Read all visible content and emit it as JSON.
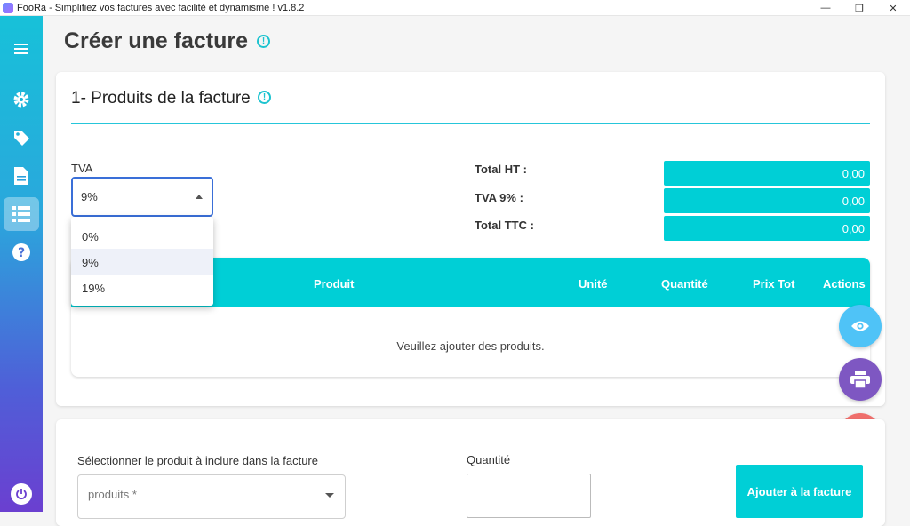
{
  "window": {
    "title": "FooRa - Simplifiez vos factures avec facilité et dynamisme ! v1.8.2",
    "controls": [
      "—",
      "❐",
      "✕"
    ]
  },
  "sidebar": {
    "items": [
      {
        "icon": "menu-icon"
      },
      {
        "icon": "gear-icon"
      },
      {
        "icon": "tag-icon"
      },
      {
        "icon": "document-icon"
      },
      {
        "icon": "list-icon",
        "active": true
      },
      {
        "icon": "help-icon"
      }
    ],
    "footer_icon": "power-icon"
  },
  "page": {
    "title": "Créer une facture",
    "info_glyph": "!"
  },
  "section1": {
    "title": "1- Produits de la facture",
    "tva_label": "TVA",
    "tva_value": "9%",
    "tva_options": [
      "0%",
      "9%",
      "19%"
    ],
    "totals": [
      {
        "label": "Total HT :",
        "value": "0,00"
      },
      {
        "label": "TVA 9% :",
        "value": "0,00"
      },
      {
        "label": "Total TTC :",
        "value": "0,00"
      }
    ],
    "table": {
      "columns": [
        "Produit",
        "Unité",
        "Quantité",
        "Prix Tot",
        "Actions"
      ],
      "empty_message": "Veuillez ajouter des produits."
    }
  },
  "section2": {
    "select_label": "Sélectionner le produit à inclure dans la facture",
    "select_placeholder": "produits *",
    "qty_label": "Quantité",
    "qty_value": "",
    "add_button": "Ajouter à la facture"
  },
  "fabs": [
    {
      "icon": "eye-icon",
      "color": "#4fc3f7"
    },
    {
      "icon": "printer-icon",
      "color": "#7e57c2"
    },
    {
      "icon": "sync-icon",
      "color": "#ef6f6c"
    }
  ],
  "colors": {
    "accent": "#00cfd6",
    "focus": "#3a6fd8"
  }
}
